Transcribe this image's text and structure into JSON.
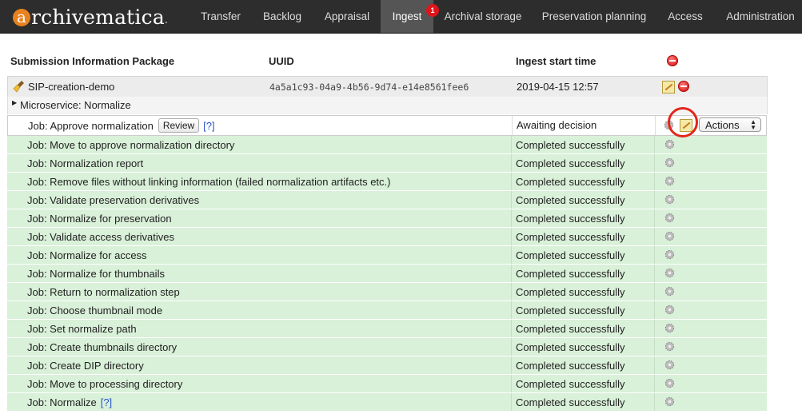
{
  "app": {
    "logo_initial": "a",
    "logo_text": "rchivematica",
    "logo_mark": "."
  },
  "nav": {
    "items": [
      "Transfer",
      "Backlog",
      "Appraisal",
      "Ingest",
      "Archival storage",
      "Preservation planning",
      "Access",
      "Administration"
    ],
    "active": "Ingest",
    "ingest_badge": "1"
  },
  "table": {
    "headers": {
      "sip": "Submission Information Package",
      "uuid": "UUID",
      "start_time": "Ingest start time"
    },
    "sip": {
      "name": "SIP-creation-demo",
      "uuid": "4a5a1c93-04a9-4b56-9d74-e14e8561fee6",
      "start_time": "2019-04-15 12:57"
    },
    "microservice": "Microservice: Normalize",
    "pending_job": {
      "name": "Job: Approve normalization",
      "review_label": "Review",
      "help": "[?]",
      "status": "Awaiting decision",
      "actions_label": "Actions"
    },
    "jobs": [
      {
        "name": "Job: Move to approve normalization directory",
        "status": "Completed successfully"
      },
      {
        "name": "Job: Normalization report",
        "status": "Completed successfully"
      },
      {
        "name": "Job: Remove files without linking information (failed normalization artifacts etc.)",
        "status": "Completed successfully"
      },
      {
        "name": "Job: Validate preservation derivatives",
        "status": "Completed successfully"
      },
      {
        "name": "Job: Normalize for preservation",
        "status": "Completed successfully"
      },
      {
        "name": "Job: Validate access derivatives",
        "status": "Completed successfully"
      },
      {
        "name": "Job: Normalize for access",
        "status": "Completed successfully"
      },
      {
        "name": "Job: Normalize for thumbnails",
        "status": "Completed successfully"
      },
      {
        "name": "Job: Return to normalization step",
        "status": "Completed successfully"
      },
      {
        "name": "Job: Choose thumbnail mode",
        "status": "Completed successfully"
      },
      {
        "name": "Job: Set normalize path",
        "status": "Completed successfully"
      },
      {
        "name": "Job: Create thumbnails directory",
        "status": "Completed successfully"
      },
      {
        "name": "Job: Create DIP directory",
        "status": "Completed successfully"
      },
      {
        "name": "Job: Move to processing directory",
        "status": "Completed successfully"
      },
      {
        "name": "Job: Normalize",
        "status": "Completed successfully",
        "help": "[?]"
      }
    ]
  },
  "colors": {
    "completed_row": "#d9f0d9",
    "nav_bg": "#2d2d2d",
    "highlight_circle": "#e3251b"
  }
}
